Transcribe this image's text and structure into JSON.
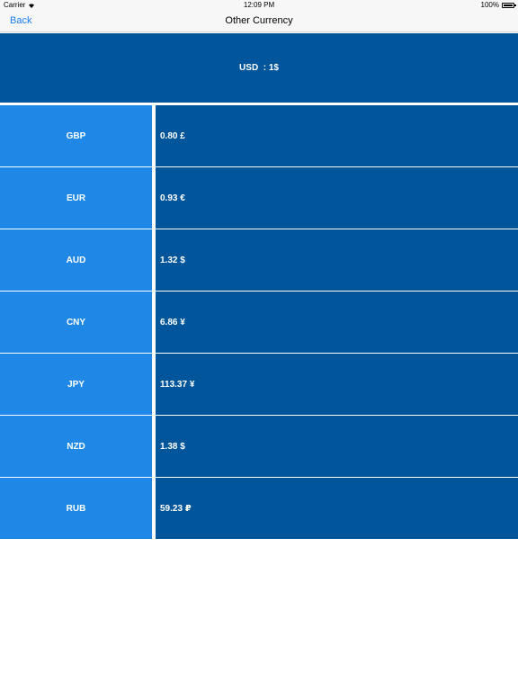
{
  "status_bar": {
    "carrier": "Carrier",
    "time": "12:09 PM",
    "battery": "100%"
  },
  "nav": {
    "back_label": "Back",
    "title": "Other Currency"
  },
  "base": {
    "label": "USD  : 1$"
  },
  "rates": [
    {
      "code": "GBP",
      "value": "0.80 £"
    },
    {
      "code": "EUR",
      "value": "0.93 €"
    },
    {
      "code": "AUD",
      "value": "1.32 $"
    },
    {
      "code": "CNY",
      "value": "6.86 ¥"
    },
    {
      "code": "JPY",
      "value": "113.37 ¥"
    },
    {
      "code": "NZD",
      "value": "1.38 $"
    },
    {
      "code": "RUB",
      "value": "59.23 ₽"
    }
  ],
  "colors": {
    "code_cell": "#1f88e6",
    "value_cell": "#01559a",
    "accent": "#1a7cf0"
  },
  "icons": {
    "wifi": "wifi-icon",
    "battery": "battery-icon"
  }
}
